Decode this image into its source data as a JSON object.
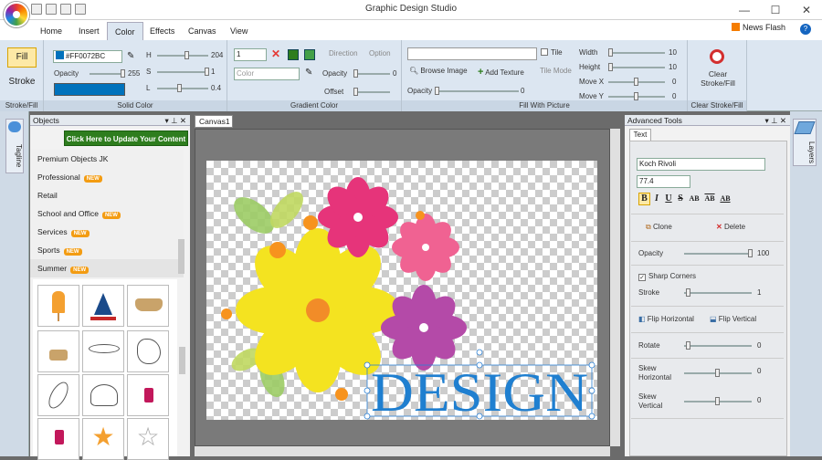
{
  "app": {
    "title": "Graphic Design Studio"
  },
  "ribbon_tabs": [
    "Home",
    "Insert",
    "Color",
    "Effects",
    "Canvas",
    "View"
  ],
  "news_flash": "News Flash",
  "help": "?",
  "stroke_fill": {
    "fill": "Fill",
    "stroke": "Stroke",
    "label": "Stroke/Fill"
  },
  "solid_color": {
    "hex": "#FF0072BC",
    "opacity_label": "Opacity",
    "opacity_value": "255",
    "h_label": "H",
    "h_value": "204",
    "s_label": "S",
    "s_value": "1",
    "l_label": "L",
    "l_value": "0.4",
    "swatch": "#0072bc",
    "label": "Solid Color"
  },
  "gradient_color": {
    "stops": "1",
    "color_placeholder": "Color",
    "direction": "Direction",
    "option": "Option",
    "opacity_label": "Opacity",
    "opacity_value": "0",
    "offset_label": "Offset",
    "label": "Gradient Color"
  },
  "fill_picture": {
    "tile": "Tile",
    "browse": "Browse Image",
    "add_texture": "Add Texture",
    "tile_mode": "Tile Mode",
    "opacity_label": "Opacity",
    "opacity_value": "0",
    "width_label": "Width",
    "width_value": "10",
    "height_label": "Height",
    "height_value": "10",
    "movex_label": "Move X",
    "movex_value": "0",
    "movey_label": "Move Y",
    "movey_value": "0",
    "label": "Fill With Picture"
  },
  "clear_group": {
    "button": "Clear Stroke/Fill",
    "label": "Clear Stroke/Fill"
  },
  "tagline_label": "Tagline",
  "layers_label": "Layers",
  "objects_panel": {
    "title": "Objects",
    "update_btn": "Click Here to Update Your Content",
    "categories": [
      {
        "label": "Premium Objects JK",
        "badge": ""
      },
      {
        "label": "Professional",
        "badge": "NEW"
      },
      {
        "label": "Retail",
        "badge": ""
      },
      {
        "label": "School and Office",
        "badge": "NEW"
      },
      {
        "label": "Services",
        "badge": "NEW"
      },
      {
        "label": "Sports",
        "badge": "NEW"
      },
      {
        "label": "Summer",
        "badge": "NEW"
      }
    ]
  },
  "canvas": {
    "tab": "Canvas1",
    "text": "DESIGN"
  },
  "advanced": {
    "title": "Advanced Tools",
    "tab": "Text",
    "font": "Koch Rivoli",
    "size": "77.4",
    "styles": [
      "B",
      "I",
      "U",
      "S",
      "AB",
      "AB",
      "AB"
    ],
    "clone": "Clone",
    "delete": "Delete",
    "opacity_label": "Opacity",
    "opacity_value": "100",
    "sharp_corners": "Sharp Corners",
    "stroke_label": "Stroke",
    "stroke_value": "1",
    "flip_h": "Flip Horizontal",
    "flip_v": "Flip Vertical",
    "rotate_label": "Rotate",
    "rotate_value": "0",
    "skew_h_label1": "Skew",
    "skew_h_label2": "Horizontal",
    "skew_h_value": "0",
    "skew_v_label1": "Skew",
    "skew_v_label2": "Vertical",
    "skew_v_value": "0"
  },
  "colors": {
    "accent_blue": "#0072bc",
    "green_btn": "#2e7d1e",
    "badge_orange": "#f39c12"
  }
}
